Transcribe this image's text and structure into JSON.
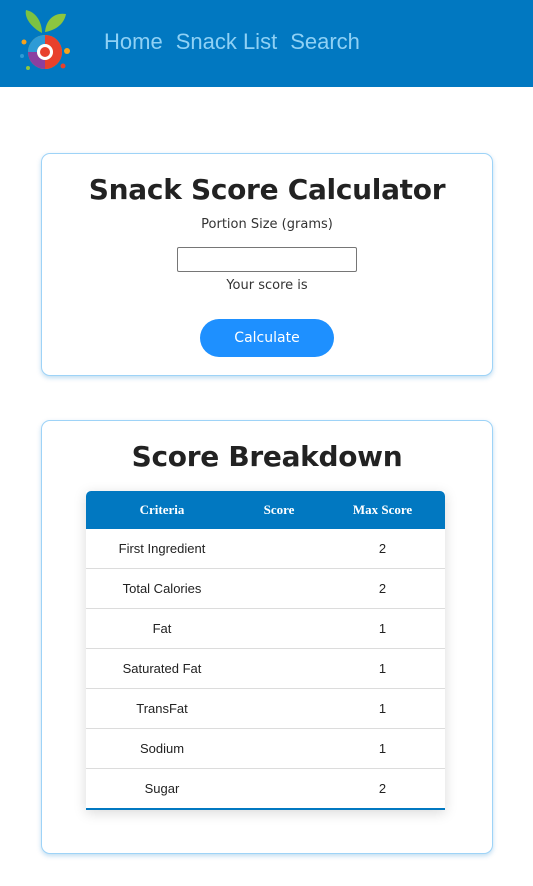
{
  "nav": {
    "items": [
      "Home",
      "Snack List",
      "Search"
    ]
  },
  "calculator": {
    "title": "Snack Score Calculator",
    "portion_label": "Portion Size (grams)",
    "portion_value": "",
    "score_text": "Your score is",
    "button_label": "Calculate"
  },
  "breakdown": {
    "title": "Score Breakdown",
    "headers": [
      "Criteria",
      "Score",
      "Max Score"
    ],
    "rows": [
      {
        "criteria": "First Ingredient",
        "score": "",
        "max": "2"
      },
      {
        "criteria": "Total Calories",
        "score": "",
        "max": "2"
      },
      {
        "criteria": "Fat",
        "score": "",
        "max": "1"
      },
      {
        "criteria": "Saturated Fat",
        "score": "",
        "max": "1"
      },
      {
        "criteria": "TransFat",
        "score": "",
        "max": "1"
      },
      {
        "criteria": "Sodium",
        "score": "",
        "max": "1"
      },
      {
        "criteria": "Sugar",
        "score": "",
        "max": "2"
      }
    ]
  },
  "colors": {
    "header_bg": "#0178c1",
    "nav_link": "#8fd1f5",
    "button": "#1e90ff",
    "card_border": "#9ed3f7"
  }
}
